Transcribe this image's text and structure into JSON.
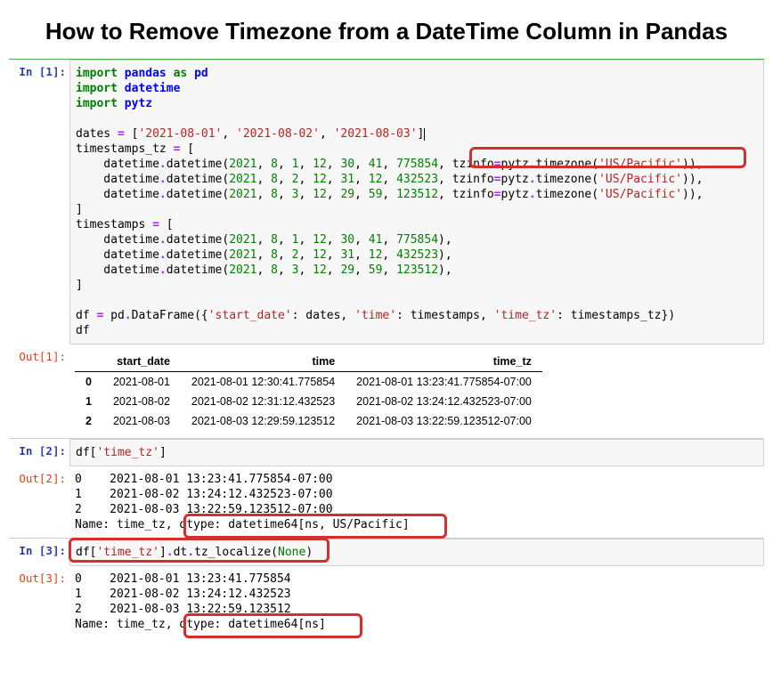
{
  "title": "How to Remove Timezone from a DateTime Column in Pandas",
  "prompts": {
    "in1": "In [1]:",
    "out1": "Out[1]:",
    "in2": "In [2]:",
    "out2": "Out[2]:",
    "in3": "In [3]:",
    "out3": "Out[3]:"
  },
  "code1": {
    "line1_import": "import",
    "line1_pandas": "pandas",
    "line1_as": "as",
    "line1_pd": "pd",
    "line2_import": "import",
    "line2_datetime": "datetime",
    "line3_import": "import",
    "line3_pytz": "pytz",
    "dates_var": "dates ",
    "eq": "=",
    "dates_open": " [",
    "d1": "'2021-08-01'",
    "d2": "'2021-08-02'",
    "d3": "'2021-08-03'",
    "dates_close": "]",
    "ts_tz_var": "timestamps_tz ",
    "open_bracket": " [",
    "dt_call_pre": "    datetime",
    "dot": ".",
    "datetime_word": "datetime(",
    "y": "2021",
    "m": "8",
    "d1n": "1",
    "d2n": "2",
    "d3n": "3",
    "h1": "12",
    "mi1": "30",
    "s1": "41",
    "us1": "775854",
    "mi2": "31",
    "s2": "12",
    "us2": "432523",
    "mi3": "29",
    "s3": "59",
    "us3": "123512",
    "tzinfo_eq": ", tzinfo",
    "pytz_tz": "pytz",
    "timezone_fn": "timezone(",
    "tz_str": "'US/Pacific'",
    "close_paren2": ")),",
    "close_bracket": "]",
    "ts_var": "timestamps ",
    "ts_close": "),",
    "df_assign": "df ",
    "pd_df": " pd",
    "DataFrame": "DataFrame({",
    "col1": "'start_date'",
    "colon_dates": ": dates, ",
    "col2": "'time'",
    "colon_ts": ": timestamps, ",
    "col3": "'time_tz'",
    "colon_tstz": ": timestamps_tz})",
    "df_expr": "df"
  },
  "table1": {
    "headers": {
      "h0": "",
      "h1": "start_date",
      "h2": "time",
      "h3": "time_tz"
    },
    "rows": [
      {
        "idx": "0",
        "start_date": "2021-08-01",
        "time": "2021-08-01 12:30:41.775854",
        "time_tz": "2021-08-01 13:23:41.775854-07:00"
      },
      {
        "idx": "1",
        "start_date": "2021-08-02",
        "time": "2021-08-02 12:31:12.432523",
        "time_tz": "2021-08-02 13:24:12.432523-07:00"
      },
      {
        "idx": "2",
        "start_date": "2021-08-03",
        "time": "2021-08-03 12:29:59.123512",
        "time_tz": "2021-08-03 13:22:59.123512-07:00"
      }
    ]
  },
  "code2": {
    "df": "df[",
    "key": "'time_tz'",
    "close": "]"
  },
  "out2": {
    "l0": "0    2021-08-01 13:23:41.775854-07:00",
    "l1": "1    2021-08-02 13:24:12.432523-07:00",
    "l2": "2    2021-08-03 13:22:59.123512-07:00",
    "l3a": "Name: time_tz, ",
    "l3b": "dtype: datetime64[ns, US/Pacific]"
  },
  "code3": {
    "df": "df[",
    "key": "'time_tz'",
    "mid": "]",
    "dt": "dt",
    "loc": "tz_localize(",
    "none": "None",
    "close": ")"
  },
  "out3": {
    "l0": "0    2021-08-01 13:23:41.775854",
    "l1": "1    2021-08-02 13:24:12.432523",
    "l2": "2    2021-08-03 13:22:59.123512",
    "l3a": "Name: time_tz, ",
    "l3b": "dtype: datetime64[ns]"
  }
}
